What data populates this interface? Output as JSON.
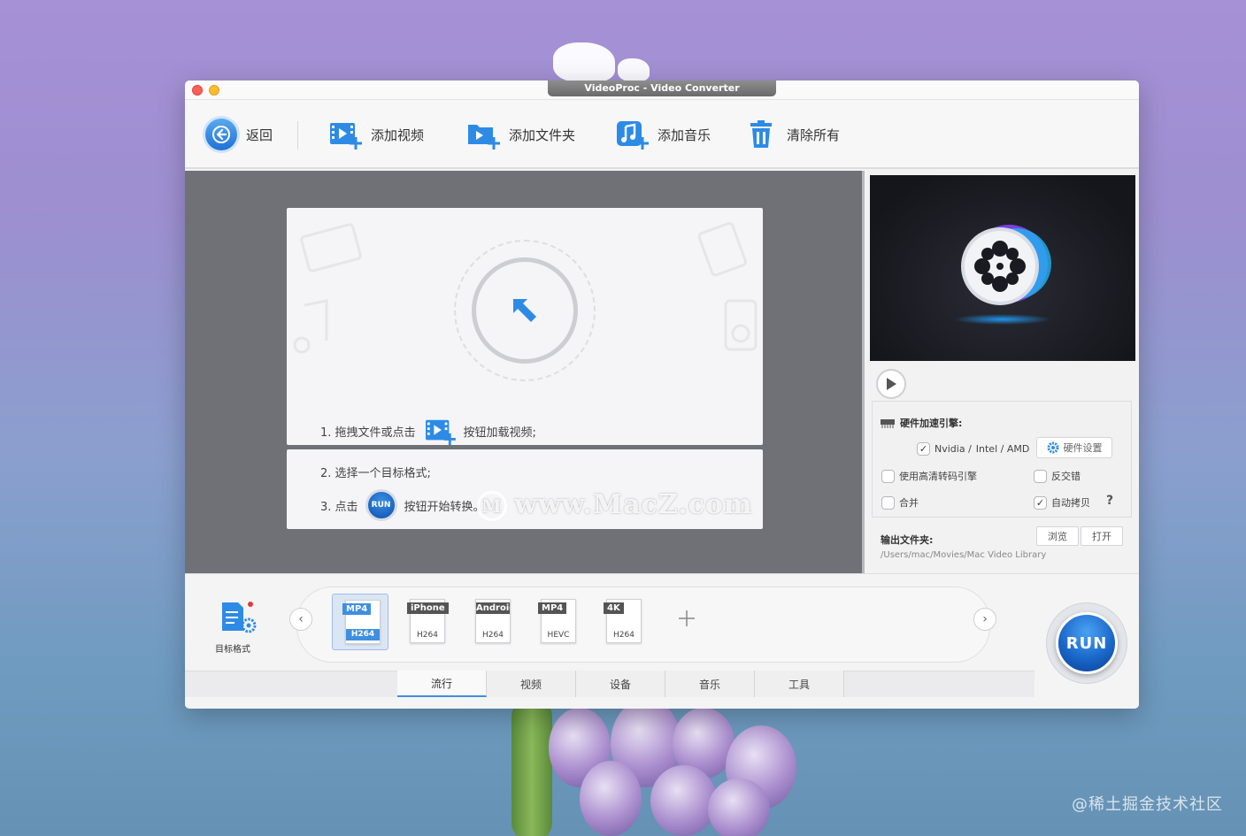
{
  "window": {
    "title": "VideoProc - Video Converter"
  },
  "toolbar": {
    "back_label": "返回",
    "add_video_label": "添加视频",
    "add_folder_label": "添加文件夹",
    "add_music_label": "添加音乐",
    "clear_all_label": "清除所有"
  },
  "drop_area": {
    "step1_prefix": "1. 拖拽文件或点击",
    "step1_suffix": "按钮加载视频;",
    "step2": "2. 选择一个目标格式;",
    "step3_prefix": "3. 点击",
    "step3_suffix": "按钮开始转换。",
    "run_small": "RUN"
  },
  "watermark": {
    "macz": "www.MacZ.com",
    "bottom": "@稀土掘金技术社区"
  },
  "options": {
    "hw_accel_label": "硬件加速引擎:",
    "nvidia_label": "Nvidia /",
    "intel_amd_label": "Intel / AMD",
    "hw_settings_label": "硬件设置",
    "hq_engine_label": "使用高清转码引擎",
    "deinterlace_label": "反交错",
    "merge_label": "合并",
    "auto_copy_label": "自动拷贝",
    "help": "?",
    "nvidia_checked": true,
    "hq_checked": false,
    "deinterlace_checked": false,
    "merge_checked": false,
    "auto_copy_checked": true
  },
  "output": {
    "label": "输出文件夹:",
    "browse_label": "浏览",
    "open_label": "打开",
    "path": "/Users/mac/Movies/Mac Video Library"
  },
  "target_format": {
    "label": "目标格式"
  },
  "formats": [
    {
      "top": "MP4",
      "bottom": "H264",
      "active": true
    },
    {
      "top": "iPhone",
      "bottom": "H264",
      "active": false
    },
    {
      "top": "Android",
      "bottom": "H264",
      "active": false
    },
    {
      "top": "MP4",
      "bottom": "HEVC",
      "active": false
    },
    {
      "top": "4K",
      "bottom": "H264",
      "active": false
    }
  ],
  "tabs": [
    "流行",
    "视频",
    "设备",
    "音乐",
    "工具"
  ],
  "run_label": "RUN",
  "colors": {
    "accent": "#3f8fe0",
    "panel_dark": "#6f7177"
  }
}
